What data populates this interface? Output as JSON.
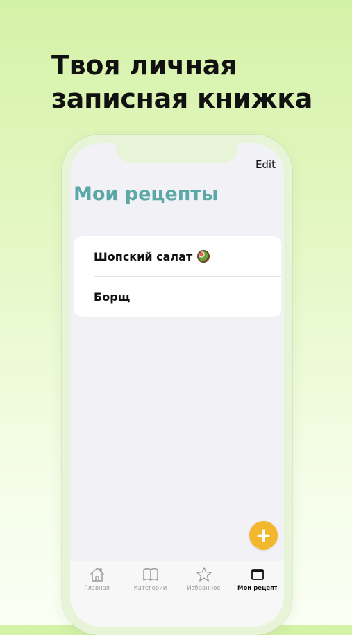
{
  "promo": {
    "headline_line1": "Твоя личная",
    "headline_line2": "записная книжка"
  },
  "navbar": {
    "edit_label": "Edit",
    "title": "Мои рецепты",
    "title_color": "#5aa8a8"
  },
  "recipes": [
    {
      "name": "Шопский салат",
      "icon": "salad-emoji"
    },
    {
      "name": "Борщ"
    }
  ],
  "fab": {
    "label": "+",
    "color": "#f3b72d"
  },
  "tabs": [
    {
      "label": "Главная",
      "icon": "home-icon",
      "active": false
    },
    {
      "label": "Категории",
      "icon": "book-icon",
      "active": false
    },
    {
      "label": "Избранное",
      "icon": "star-icon",
      "active": false
    },
    {
      "label": "Мои рецепты",
      "icon": "window-icon",
      "active": true
    }
  ]
}
